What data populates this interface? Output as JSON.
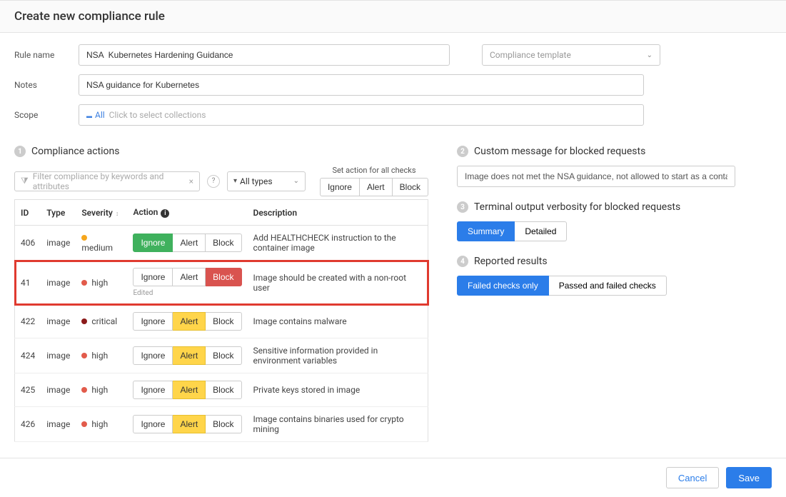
{
  "header": {
    "title": "Create new compliance rule"
  },
  "form": {
    "rule_name_label": "Rule name",
    "rule_name_value": "NSA  Kubernetes Hardening Guidance",
    "template_placeholder": "Compliance template",
    "notes_label": "Notes",
    "notes_value": "NSA guidance for Kubernetes",
    "scope_label": "Scope",
    "scope_all": "All",
    "scope_placeholder": "Click to select collections"
  },
  "compliance": {
    "title": "Compliance actions",
    "filter_placeholder": "Filter compliance by keywords and attributes",
    "types_label": "All types",
    "set_all_label": "Set action for all checks",
    "set_all_ignore": "Ignore",
    "set_all_alert": "Alert",
    "set_all_block": "Block",
    "columns": {
      "id": "ID",
      "type": "Type",
      "severity": "Severity",
      "action": "Action",
      "description": "Description"
    },
    "edited_label": "Edited",
    "actions": {
      "ignore": "Ignore",
      "alert": "Alert",
      "block": "Block"
    },
    "rows": [
      {
        "id": "406",
        "type": "image",
        "severity": "medium",
        "selected": "ignore",
        "description": "Add HEALTHCHECK instruction to the container image"
      },
      {
        "id": "41",
        "type": "image",
        "severity": "high",
        "selected": "block",
        "edited": true,
        "highlighted": true,
        "description": "Image should be created with a non-root user"
      },
      {
        "id": "422",
        "type": "image",
        "severity": "critical",
        "selected": "alert",
        "description": "Image contains malware"
      },
      {
        "id": "424",
        "type": "image",
        "severity": "high",
        "selected": "alert",
        "description": "Sensitive information provided in environment variables"
      },
      {
        "id": "425",
        "type": "image",
        "severity": "high",
        "selected": "alert",
        "description": "Private keys stored in image"
      },
      {
        "id": "426",
        "type": "image",
        "severity": "high",
        "selected": "alert",
        "description": "Image contains binaries used for crypto mining"
      }
    ]
  },
  "custom_msg": {
    "title": "Custom message for blocked requests",
    "value": "Image does not met the NSA guidance, not allowed to start as a container."
  },
  "verbosity": {
    "title": "Terminal output verbosity for blocked requests",
    "summary": "Summary",
    "detailed": "Detailed"
  },
  "reported": {
    "title": "Reported results",
    "failed": "Failed checks only",
    "passed": "Passed and failed checks"
  },
  "footer": {
    "cancel": "Cancel",
    "save": "Save"
  }
}
